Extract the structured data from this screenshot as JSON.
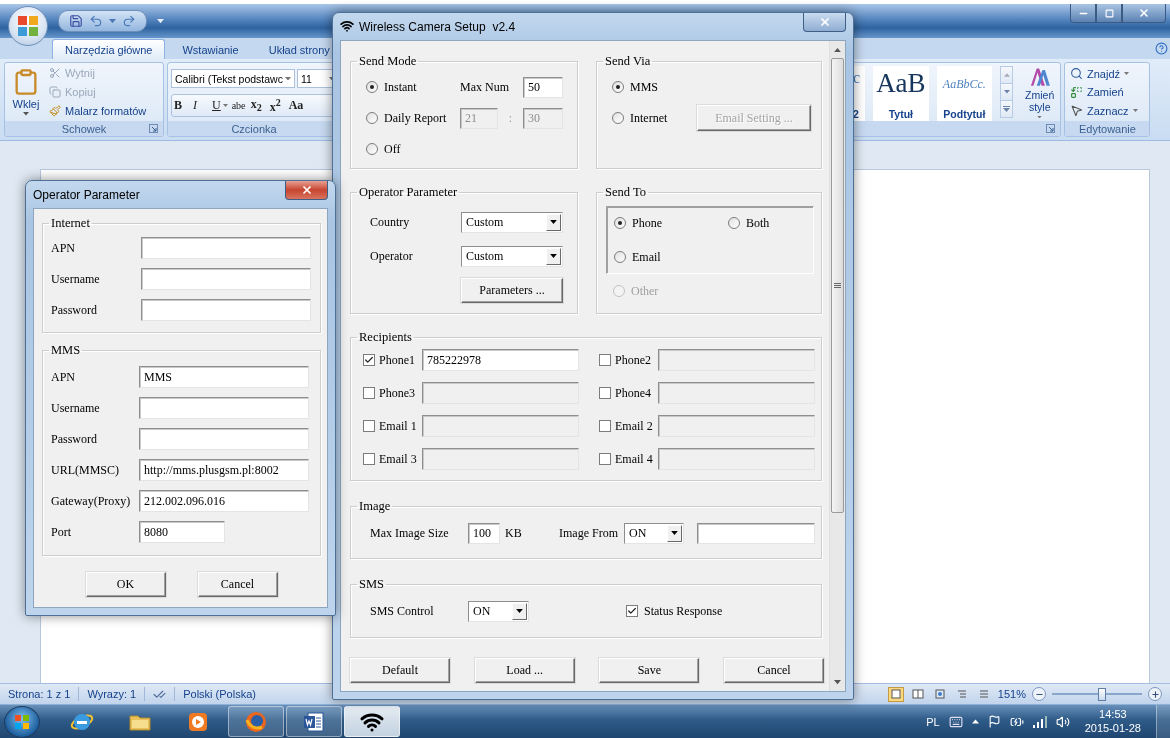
{
  "word": {
    "tabs": [
      {
        "label": "Narzędzia główne",
        "selected": true
      },
      {
        "label": "Wstawianie",
        "selected": false
      },
      {
        "label": "Układ strony",
        "selected": false
      }
    ],
    "clipboard": {
      "paste": "Wklej",
      "items": [
        {
          "label": "Wytnij",
          "kind": "cut",
          "disabled": true
        },
        {
          "label": "Kopiuj",
          "kind": "copy",
          "disabled": true
        },
        {
          "label": "Malarz formatów",
          "kind": "painter",
          "disabled": false
        }
      ],
      "title": "Schowek"
    },
    "font": {
      "name": "Calibri (Tekst podstawc",
      "size": "11",
      "buttons": [
        {
          "label": "B",
          "kind": "bold",
          "menu": false
        },
        {
          "label": "I",
          "kind": "italic",
          "menu": false
        },
        {
          "label": "U",
          "kind": "underline",
          "menu": true
        },
        {
          "label": "abe",
          "kind": "strike",
          "menu": false
        },
        {
          "label": "x$_{2}$",
          "kind": "sub",
          "menu": false
        },
        {
          "label": "x$^{2}$",
          "kind": "sup",
          "menu": false
        },
        {
          "label": "Aa",
          "kind": "case",
          "menu": false
        }
      ],
      "title": "Czcionka"
    },
    "styles": {
      "items": [
        {
          "kind": "partial",
          "preview": "c",
          "label": "2"
        },
        {
          "kind": "title",
          "preview": "AaB",
          "label": "Tytuł"
        },
        {
          "kind": "subtitle",
          "preview": "AaBbCc.",
          "label": "Podtytuł"
        }
      ],
      "change": "Zmień style"
    },
    "editing": {
      "items": [
        {
          "label": "Znajdź",
          "kind": "find",
          "menu": true
        },
        {
          "label": "Zamień",
          "kind": "replace",
          "menu": false
        },
        {
          "label": "Zaznacz",
          "kind": "select",
          "menu": true
        }
      ],
      "title": "Edytowanie"
    },
    "status_bar": {
      "page": "Strona: 1 z 1",
      "words": "Wyrazy: 1",
      "language": "Polski (Polska)",
      "zoom": "151%",
      "zoom_slider": {
        "level": 0.55
      }
    }
  },
  "taskbar": {
    "apps": [
      {
        "kind": "ie",
        "open": false,
        "active": false
      },
      {
        "kind": "explorer",
        "open": false,
        "active": false
      },
      {
        "kind": "media",
        "open": false,
        "active": false
      },
      {
        "kind": "firefox",
        "open": true,
        "active": false
      },
      {
        "kind": "word",
        "open": true,
        "active": false
      },
      {
        "kind": "wifi",
        "open": true,
        "active": true
      }
    ],
    "language": "PL",
    "time": "14:53",
    "date": "2015-01-28"
  },
  "camera_setup": {
    "title": "Wireless Camera Setup  v2.4",
    "send_mode": {
      "title": "Send Mode",
      "options": [
        {
          "label": "Instant",
          "selected": true
        },
        {
          "label": "Daily Report",
          "selected": false
        },
        {
          "label": "Off",
          "selected": false
        }
      ],
      "max_num_label": "Max Num",
      "max_num": "50",
      "hour": "21",
      "separator": ":",
      "minute": "30",
      "time_disabled": true
    },
    "send_via": {
      "title": "Send Via",
      "options": [
        {
          "label": "MMS",
          "selected": true
        },
        {
          "label": "Internet",
          "selected": false
        }
      ],
      "email_setting": {
        "label": "Email Setting ...",
        "disabled": true
      }
    },
    "operator": {
      "title": "Operator Parameter",
      "country_label": "Country",
      "country": "Custom",
      "operator_label": "Operator",
      "operator": "Custom",
      "parameters": "Parameters ..."
    },
    "send_to": {
      "title": "Send To",
      "box_options": [
        {
          "label": "Phone",
          "selected": true
        },
        {
          "label": "Both",
          "selected": false
        },
        {
          "label": "Email",
          "selected": false
        }
      ],
      "other": {
        "label": "Other",
        "selected": false,
        "disabled": true
      }
    },
    "recipients": {
      "title": "Recipients",
      "items": [
        {
          "label": "Phone1",
          "checked": true,
          "value": "785222978"
        },
        {
          "label": "Phone2",
          "checked": false
        },
        {
          "label": "Phone3",
          "checked": false
        },
        {
          "label": "Phone4",
          "checked": false
        },
        {
          "label": "Email 1",
          "checked": false
        },
        {
          "label": "Email 2",
          "checked": false
        },
        {
          "label": "Email 3",
          "checked": false
        },
        {
          "label": "Email 4",
          "checked": false
        }
      ]
    },
    "image": {
      "title": "Image",
      "size_label": "Max Image Size",
      "size": "100",
      "unit": "KB",
      "source_label": "Image From",
      "source": "ON"
    },
    "sms": {
      "title": "SMS",
      "control_label": "SMS Control",
      "control": "ON",
      "status_response": {
        "label": "Status Response",
        "checked": true
      }
    },
    "buttons": [
      "Default",
      "Load ...",
      "Save",
      "Cancel"
    ]
  },
  "operator_parameter": {
    "title": "Operator Parameter",
    "groups": [
      {
        "title": "Internet",
        "fields": [
          {
            "label": "APN",
            "kind": "long"
          },
          {
            "label": "Username",
            "kind": "long"
          },
          {
            "label": "Password",
            "kind": "long"
          }
        ]
      },
      {
        "title": "MMS",
        "fields": [
          {
            "label": "APN",
            "value": "MMS",
            "kind": "long"
          },
          {
            "label": "Username",
            "kind": "long"
          },
          {
            "label": "Password",
            "kind": "long"
          },
          {
            "label": "URL(MMSC)",
            "value": "http://mms.plusgsm.pl:8002",
            "kind": "long"
          },
          {
            "label": "Gateway(Proxy)",
            "value": "212.002.096.016",
            "kind": "long"
          },
          {
            "label": "Port",
            "value": "8080",
            "kind": "short"
          }
        ]
      }
    ],
    "buttons": [
      "OK",
      "Cancel"
    ]
  }
}
